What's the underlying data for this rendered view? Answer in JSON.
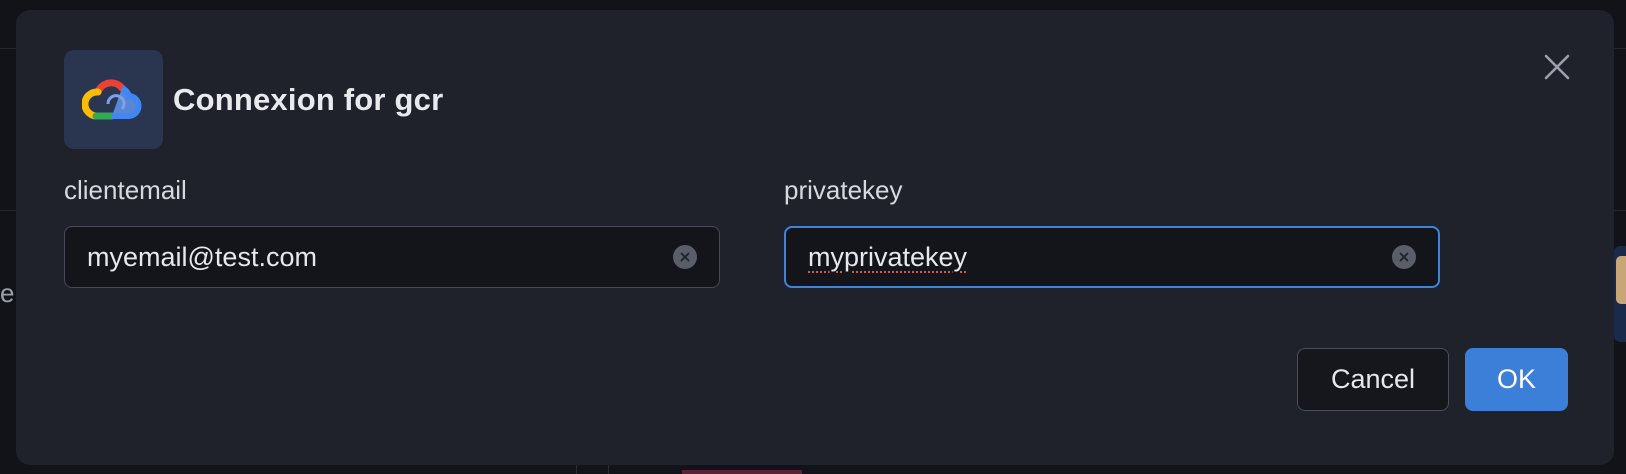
{
  "dialog": {
    "title": "Connexion for gcr",
    "logo_icon": "google-cloud-icon",
    "close_icon": "close-icon"
  },
  "fields": {
    "client_email": {
      "label": "clientemail",
      "value": "myemail@test.com"
    },
    "private_key": {
      "label": "privatekey",
      "value": "myprivatekey"
    }
  },
  "buttons": {
    "cancel_label": "Cancel",
    "ok_label": "OK"
  },
  "background": {
    "left_fragment_text": "er"
  },
  "colors": {
    "accent": "#3b7fd9",
    "dialog_bg": "#1f222b",
    "focus_border": "#3f84dc"
  }
}
